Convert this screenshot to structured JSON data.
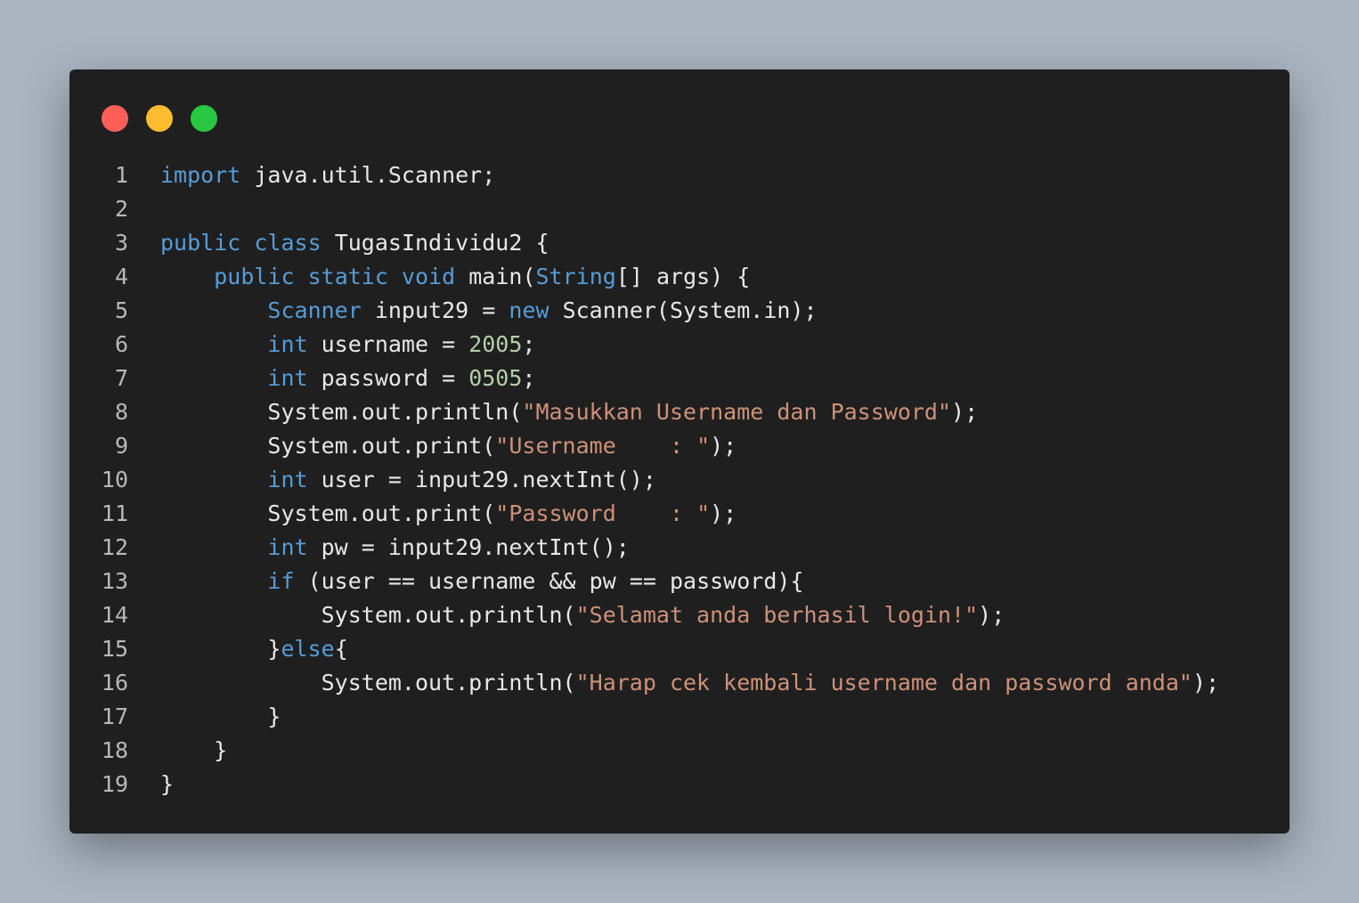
{
  "window": {
    "controls": [
      {
        "name": "close",
        "color": "#ff5f57"
      },
      {
        "name": "minimize",
        "color": "#febc2e"
      },
      {
        "name": "maximize",
        "color": "#28c840"
      }
    ]
  },
  "colors": {
    "keyword": "#569cd6",
    "string": "#ce9178",
    "number": "#b5cea8",
    "plain": "#e8e8e8",
    "line_number": "#b8b8b8"
  },
  "code": {
    "language": "java",
    "lines": [
      {
        "n": "1",
        "tokens": [
          [
            "kw",
            "import"
          ],
          [
            "t",
            " java.util.Scanner;"
          ]
        ]
      },
      {
        "n": "2",
        "tokens": []
      },
      {
        "n": "3",
        "tokens": [
          [
            "kw",
            "public"
          ],
          [
            "t",
            " "
          ],
          [
            "kw",
            "class"
          ],
          [
            "t",
            " TugasIndividu2 {"
          ]
        ]
      },
      {
        "n": "4",
        "tokens": [
          [
            "t",
            "    "
          ],
          [
            "kw",
            "public"
          ],
          [
            "t",
            " "
          ],
          [
            "kw",
            "static"
          ],
          [
            "t",
            " "
          ],
          [
            "kw",
            "void"
          ],
          [
            "t",
            " main("
          ],
          [
            "kw",
            "String"
          ],
          [
            "t",
            "[] args) {"
          ]
        ]
      },
      {
        "n": "5",
        "tokens": [
          [
            "t",
            "        "
          ],
          [
            "kw",
            "Scanner"
          ],
          [
            "t",
            " input29 = "
          ],
          [
            "kw",
            "new"
          ],
          [
            "t",
            " Scanner(System.in);"
          ]
        ]
      },
      {
        "n": "6",
        "tokens": [
          [
            "t",
            "        "
          ],
          [
            "kw",
            "int"
          ],
          [
            "t",
            " username = "
          ],
          [
            "num",
            "2005"
          ],
          [
            "t",
            ";"
          ]
        ]
      },
      {
        "n": "7",
        "tokens": [
          [
            "t",
            "        "
          ],
          [
            "kw",
            "int"
          ],
          [
            "t",
            " password = "
          ],
          [
            "num",
            "0505"
          ],
          [
            "t",
            ";"
          ]
        ]
      },
      {
        "n": "8",
        "tokens": [
          [
            "t",
            "        System.out.println("
          ],
          [
            "str",
            "\"Masukkan Username dan Password\""
          ],
          [
            "t",
            ");"
          ]
        ]
      },
      {
        "n": "9",
        "tokens": [
          [
            "t",
            "        System.out.print("
          ],
          [
            "str",
            "\"Username    : \""
          ],
          [
            "t",
            ");"
          ]
        ]
      },
      {
        "n": "10",
        "tokens": [
          [
            "t",
            "        "
          ],
          [
            "kw",
            "int"
          ],
          [
            "t",
            " user = input29.nextInt();"
          ]
        ]
      },
      {
        "n": "11",
        "tokens": [
          [
            "t",
            "        System.out.print("
          ],
          [
            "str",
            "\"Password    : \""
          ],
          [
            "t",
            ");"
          ]
        ]
      },
      {
        "n": "12",
        "tokens": [
          [
            "t",
            "        "
          ],
          [
            "kw",
            "int"
          ],
          [
            "t",
            " pw = input29.nextInt();"
          ]
        ]
      },
      {
        "n": "13",
        "tokens": [
          [
            "t",
            "        "
          ],
          [
            "kw",
            "if"
          ],
          [
            "t",
            " (user == username && pw == password){"
          ]
        ]
      },
      {
        "n": "14",
        "tokens": [
          [
            "t",
            "            System.out.println("
          ],
          [
            "str",
            "\"Selamat anda berhasil login!\""
          ],
          [
            "t",
            ");"
          ]
        ]
      },
      {
        "n": "15",
        "tokens": [
          [
            "t",
            "        }"
          ],
          [
            "kw",
            "else"
          ],
          [
            "t",
            "{"
          ]
        ]
      },
      {
        "n": "16",
        "tokens": [
          [
            "t",
            "            System.out.println("
          ],
          [
            "str",
            "\"Harap cek kembali username dan password anda\""
          ],
          [
            "t",
            ");"
          ]
        ]
      },
      {
        "n": "17",
        "tokens": [
          [
            "t",
            "        }"
          ]
        ]
      },
      {
        "n": "18",
        "tokens": [
          [
            "t",
            "    }"
          ]
        ]
      },
      {
        "n": "19",
        "tokens": [
          [
            "t",
            "}"
          ]
        ]
      }
    ]
  }
}
